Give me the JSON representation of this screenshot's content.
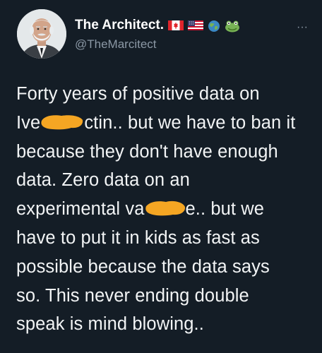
{
  "tweet": {
    "author": {
      "display_name": "The Architect.",
      "handle": "@TheMarcitect",
      "name_emojis": [
        "canada-flag-icon",
        "usa-flag-icon",
        "globe-icon",
        "frog-icon"
      ]
    },
    "more_label": "···",
    "body_lines": [
      {
        "before": "Forty years of positive data on",
        "after": ""
      },
      {
        "before": "Ive",
        "after": "ctin.. but we have to ban it"
      },
      {
        "before": "because they don't have enough",
        "after": ""
      },
      {
        "before": "data. Zero data on an",
        "after": ""
      },
      {
        "before": "experimental va",
        "after": "e.. but we"
      },
      {
        "before": "have to put it in kids as fast as",
        "after": ""
      },
      {
        "before": "possible because the data says",
        "after": ""
      },
      {
        "before": "so. This never ending double",
        "after": ""
      },
      {
        "before": "speak is mind blowing..",
        "after": ""
      }
    ]
  },
  "colors": {
    "background": "#141d26",
    "text": "#f2f4f5",
    "muted": "#8b98a5",
    "redaction": "#f5a623"
  }
}
